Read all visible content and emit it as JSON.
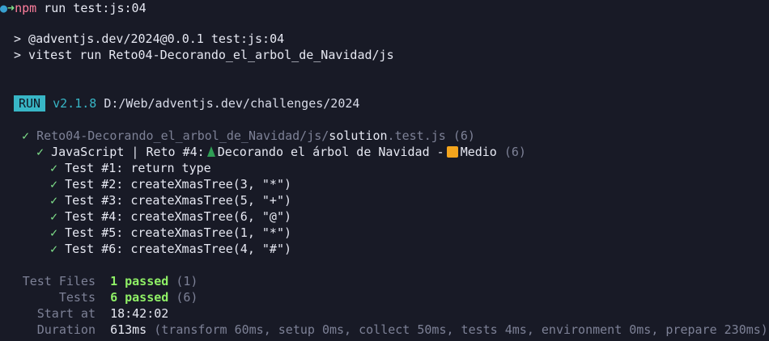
{
  "prompt": {
    "dot": "●",
    "arrow": "➜",
    "command_name": "npm",
    "command_args": " run test:js:04"
  },
  "npm_output": {
    "line1": "> @adventjs.dev/2024@0.0.1 test:js:04",
    "line2": "> vitest run Reto04-Decorando_el_arbol_de_Navidad/js"
  },
  "run_header": {
    "badge": "RUN",
    "version": "v2.1.8",
    "path": "D:/Web/adventjs.dev/challenges/2024"
  },
  "file_result": {
    "check": "✓",
    "path_prefix": "Reto04-Decorando_el_arbol_de_Navidad/js/",
    "file_name": "solution",
    "file_ext": ".test.js",
    "count": "(6)"
  },
  "suite": {
    "check": "✓",
    "title_before_icon": "JavaScript | Reto #4:",
    "tree_icon": "tree-icon",
    "title_after_icon": "Decorando el árbol de Navidad -",
    "difficulty_icon": "orange-square-icon",
    "difficulty": "Medio",
    "count": "(6)"
  },
  "tests": [
    {
      "check": "✓",
      "name": "Test #1: return type"
    },
    {
      "check": "✓",
      "name": "Test #2: createXmasTree(3, \"*\")"
    },
    {
      "check": "✓",
      "name": "Test #3: createXmasTree(5, \"+\")"
    },
    {
      "check": "✓",
      "name": "Test #4: createXmasTree(6, \"@\")"
    },
    {
      "check": "✓",
      "name": "Test #5: createXmasTree(1, \"*\")"
    },
    {
      "check": "✓",
      "name": "Test #6: createXmasTree(4, \"#\")"
    }
  ],
  "summary": {
    "test_files_label": "Test Files",
    "test_files_passed": "1 passed",
    "test_files_total": "(1)",
    "tests_label": "Tests",
    "tests_passed": "6 passed",
    "tests_total": "(6)",
    "start_label": "Start at",
    "start_value": "18:42:02",
    "duration_label": "Duration",
    "duration_value": "613ms",
    "duration_detail": "(transform 60ms, setup 0ms, collect 50ms, tests 4ms, environment 0ms, prepare 230ms)"
  },
  "colors": {
    "background": "#181a26",
    "green": "#7fe08a",
    "cyan": "#38b6c6",
    "pink": "#ff7f9d",
    "dim": "#7d8196",
    "orange": "#f4a51d"
  }
}
